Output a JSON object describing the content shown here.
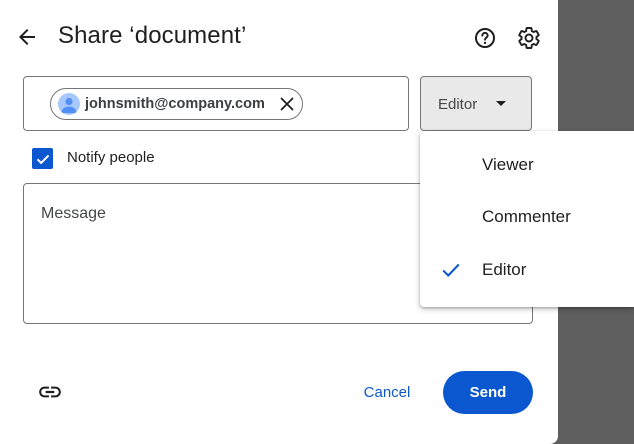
{
  "dialog": {
    "title": "Share ‘document’",
    "back_icon": "arrow-left-icon",
    "help_icon": "help-circle-icon",
    "settings_icon": "gear-icon"
  },
  "people": {
    "chips": [
      {
        "email": "johnsmith@company.com",
        "avatar_icon": "person-avatar-icon",
        "remove_icon": "close-icon"
      }
    ]
  },
  "role_select": {
    "value": "Editor",
    "arrow_icon": "triangle-down-icon"
  },
  "role_menu": {
    "items": [
      {
        "label": "Viewer",
        "selected": false
      },
      {
        "label": "Commenter",
        "selected": false
      },
      {
        "label": "Editor",
        "selected": true
      }
    ],
    "check_icon": "check-icon"
  },
  "notify": {
    "label": "Notify people",
    "checked": true
  },
  "message": {
    "placeholder": "Message",
    "value": ""
  },
  "footer": {
    "link_icon": "link-icon",
    "cancel_label": "Cancel",
    "send_label": "Send"
  },
  "colors": {
    "accent": "#0b57d0",
    "backdrop": "#5f5f5f",
    "select_bg": "#e9e9e9",
    "avatar_bg": "#a8c7fa"
  }
}
